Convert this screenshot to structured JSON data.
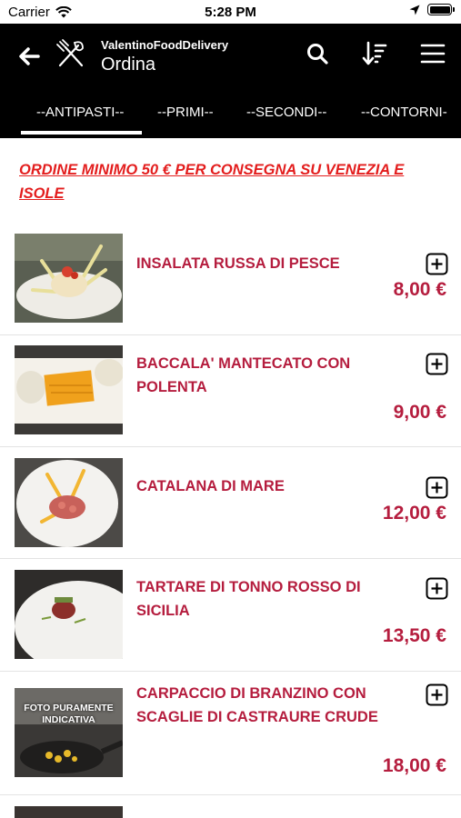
{
  "status_bar": {
    "carrier": "Carrier",
    "time": "5:28 PM"
  },
  "header": {
    "app_name": "ValentinoFoodDelivery",
    "title": "Ordina"
  },
  "tabs": [
    {
      "label": "--ANTIPASTI--"
    },
    {
      "label": "--PRIMI--"
    },
    {
      "label": "--SECONDI--"
    },
    {
      "label": "--CONTORNI-"
    }
  ],
  "notice": "ORDINE MINIMO 50 € PER CONSEGNA SU VENEZIA E ISOLE",
  "products": [
    {
      "name": "INSALATA RUSSA DI PESCE",
      "price": "8,00 €"
    },
    {
      "name": "BACCALA' MANTECATO CON POLENTA",
      "price": "9,00 €"
    },
    {
      "name": "CATALANA DI MARE",
      "price": "12,00 €"
    },
    {
      "name": "TARTARE DI TONNO ROSSO DI SICILIA",
      "price": "13,50 €"
    },
    {
      "name": "CARPACCIO DI BRANZINO CON SCAGLIE DI CASTRAURE CRUDE",
      "price": "18,00 €",
      "image_label": "FOTO PURAMENTE INDICATIVA"
    }
  ],
  "colors": {
    "accent": "#b51d3e",
    "notice": "#e31d1d",
    "header_bg": "#000000"
  }
}
